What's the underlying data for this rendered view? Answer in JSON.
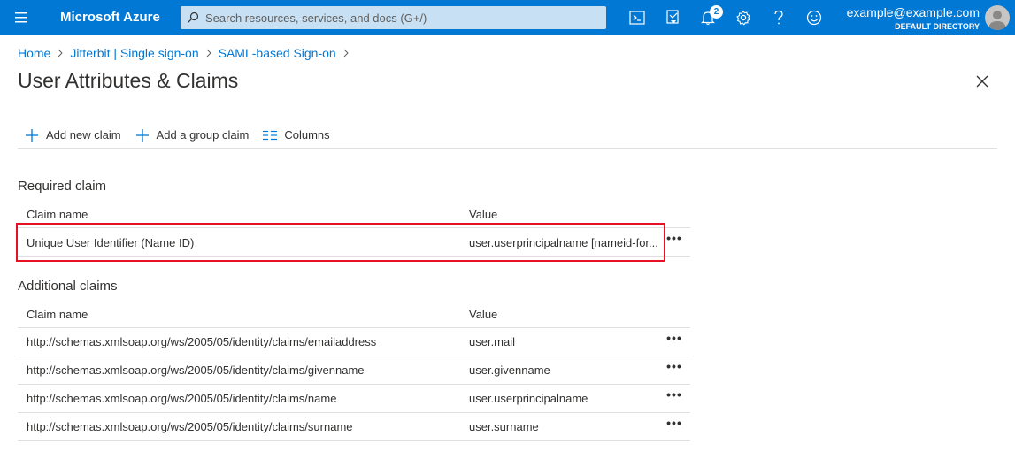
{
  "topbar": {
    "brand": "Microsoft Azure",
    "search_placeholder": "Search resources, services, and docs (G+/)",
    "notifications_count": "2",
    "account_email": "example@example.com",
    "account_directory": "DEFAULT DIRECTORY"
  },
  "breadcrumb": [
    "Home",
    "Jitterbit | Single sign-on",
    "SAML-based Sign-on"
  ],
  "page_title": "User Attributes & Claims",
  "toolbar": {
    "add_new_claim": "Add new claim",
    "add_group_claim": "Add a group claim",
    "columns": "Columns"
  },
  "required": {
    "title": "Required claim",
    "col_name": "Claim name",
    "col_value": "Value",
    "rows": [
      {
        "name": "Unique User Identifier (Name ID)",
        "value": "user.userprincipalname [nameid-for..."
      }
    ]
  },
  "additional": {
    "title": "Additional claims",
    "col_name": "Claim name",
    "col_value": "Value",
    "rows": [
      {
        "name": "http://schemas.xmlsoap.org/ws/2005/05/identity/claims/emailaddress",
        "value": "user.mail"
      },
      {
        "name": "http://schemas.xmlsoap.org/ws/2005/05/identity/claims/givenname",
        "value": "user.givenname"
      },
      {
        "name": "http://schemas.xmlsoap.org/ws/2005/05/identity/claims/name",
        "value": "user.userprincipalname"
      },
      {
        "name": "http://schemas.xmlsoap.org/ws/2005/05/identity/claims/surname",
        "value": "user.surname"
      }
    ]
  },
  "more_glyph": "•••",
  "colors": {
    "accent": "#0078d4",
    "highlight_border": "#e81123"
  }
}
